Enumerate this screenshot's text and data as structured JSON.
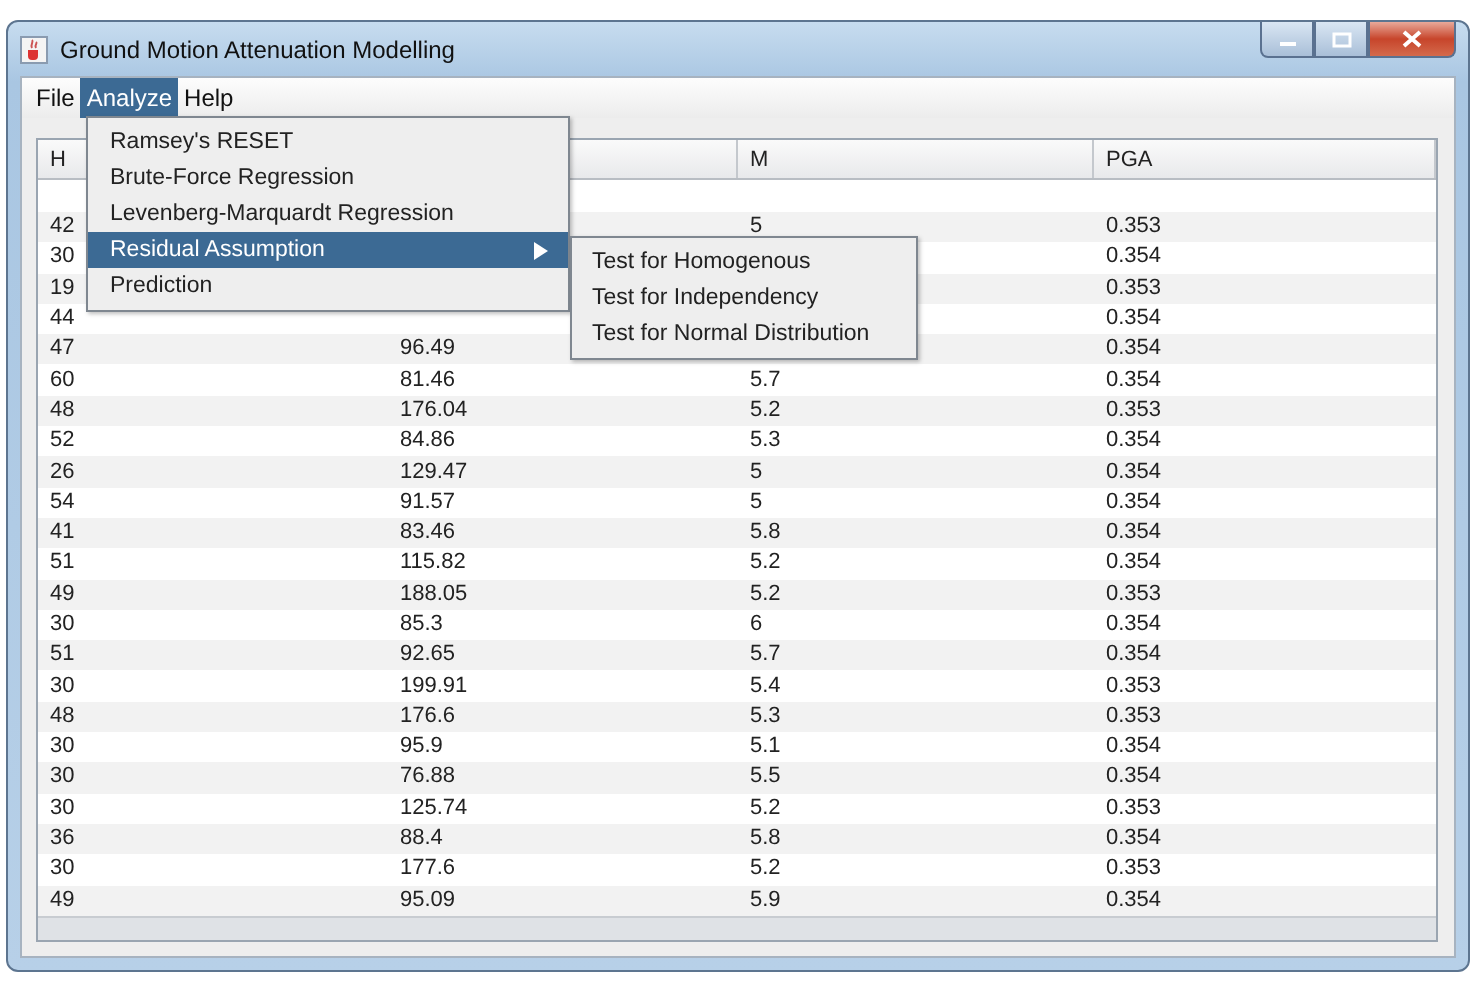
{
  "window": {
    "title": "Ground Motion Attenuation Modelling"
  },
  "menu_bar": [
    {
      "label": "File",
      "selected": false
    },
    {
      "label": "Analyze",
      "selected": true
    },
    {
      "label": "Help",
      "selected": false
    }
  ],
  "analyze_menu": [
    {
      "label": "Ramsey's RESET",
      "selected": false,
      "has_submenu": false
    },
    {
      "label": "Brute-Force Regression",
      "selected": false,
      "has_submenu": false
    },
    {
      "label": "Levenberg-Marquardt Regression",
      "selected": false,
      "has_submenu": false
    },
    {
      "label": "Residual Assumption",
      "selected": true,
      "has_submenu": true
    },
    {
      "label": "Prediction",
      "selected": false,
      "has_submenu": false
    }
  ],
  "residual_submenu": [
    {
      "label": "Test for Homogenous"
    },
    {
      "label": "Test for Independency"
    },
    {
      "label": "Test for Normal Distribution"
    }
  ],
  "table": {
    "columns": [
      "H",
      null,
      "M",
      "PGA"
    ],
    "rows": [
      [
        "42",
        null,
        "5",
        "0.353"
      ],
      [
        "30",
        null,
        null,
        "0.354"
      ],
      [
        "19",
        null,
        null,
        "0.353"
      ],
      [
        "44",
        null,
        null,
        "0.354"
      ],
      [
        "47",
        "96.49",
        null,
        "0.354"
      ],
      [
        "60",
        "81.46",
        "5.7",
        "0.354"
      ],
      [
        "48",
        "176.04",
        "5.2",
        "0.353"
      ],
      [
        "52",
        "84.86",
        "5.3",
        "0.354"
      ],
      [
        "26",
        "129.47",
        "5",
        "0.354"
      ],
      [
        "54",
        "91.57",
        "5",
        "0.354"
      ],
      [
        "41",
        "83.46",
        "5.8",
        "0.354"
      ],
      [
        "51",
        "115.82",
        "5.2",
        "0.354"
      ],
      [
        "49",
        "188.05",
        "5.2",
        "0.353"
      ],
      [
        "30",
        "85.3",
        "6",
        "0.354"
      ],
      [
        "51",
        "92.65",
        "5.7",
        "0.354"
      ],
      [
        "30",
        "199.91",
        "5.4",
        "0.353"
      ],
      [
        "48",
        "176.6",
        "5.3",
        "0.353"
      ],
      [
        "30",
        "95.9",
        "5.1",
        "0.354"
      ],
      [
        "30",
        "76.88",
        "5.5",
        "0.354"
      ],
      [
        "30",
        "125.74",
        "5.2",
        "0.353"
      ],
      [
        "36",
        "88.4",
        "5.8",
        "0.354"
      ],
      [
        "30",
        "177.6",
        "5.2",
        "0.353"
      ],
      [
        "49",
        "95.09",
        "5.9",
        "0.354"
      ]
    ]
  }
}
